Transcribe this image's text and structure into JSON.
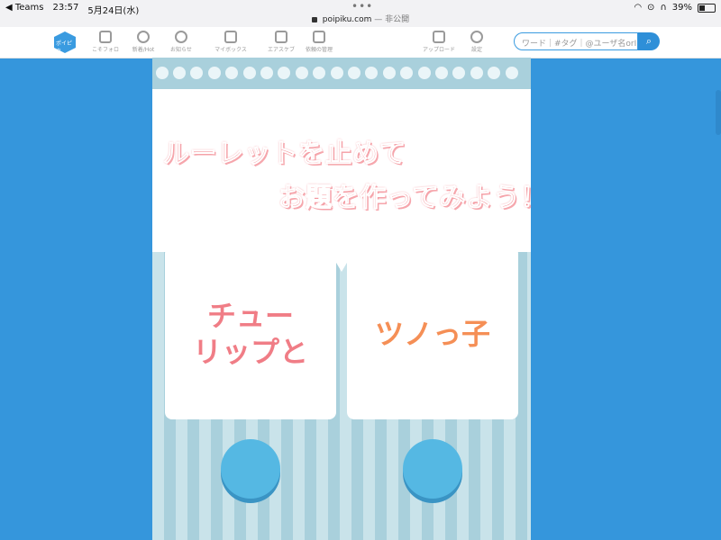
{
  "status_bar": {
    "back_app": "◀ Teams",
    "time": "23:57",
    "date": "5月24日(水)",
    "url": "poipiku.com",
    "url_suffix": "— 非公開",
    "battery": "39%"
  },
  "nav": {
    "logo_text": "ポイピク",
    "items": [
      {
        "label": "こそフォロ",
        "icon": "home-icon"
      },
      {
        "label": "新着/Hot",
        "icon": "clock-icon"
      },
      {
        "label": "お知らせ",
        "icon": "smile-icon"
      },
      {
        "label": "マイボックス",
        "icon": "box-icon"
      },
      {
        "label": "エアスケブ",
        "icon": "sketchbook-icon"
      },
      {
        "label": "依頼の管理",
        "icon": "folder-icon"
      },
      {
        "label": "アップロード",
        "icon": "upload-icon"
      },
      {
        "label": "設定",
        "icon": "gear-icon"
      }
    ],
    "search_placeholder": "ワード｜#タグ｜@ユーザ名orID"
  },
  "content": {
    "headline_line1": "ルーレットを止めて",
    "headline_line2": "お題を作ってみよう！",
    "card_left_line1": "チュー",
    "card_left_line2": "リップと",
    "card_right": "ツノっ子",
    "colors": {
      "background": "#3596dc",
      "headline": "#f07d86",
      "left_card_text": "#f07d86",
      "right_card_text": "#f58f56",
      "button": "#55b8e3"
    }
  }
}
